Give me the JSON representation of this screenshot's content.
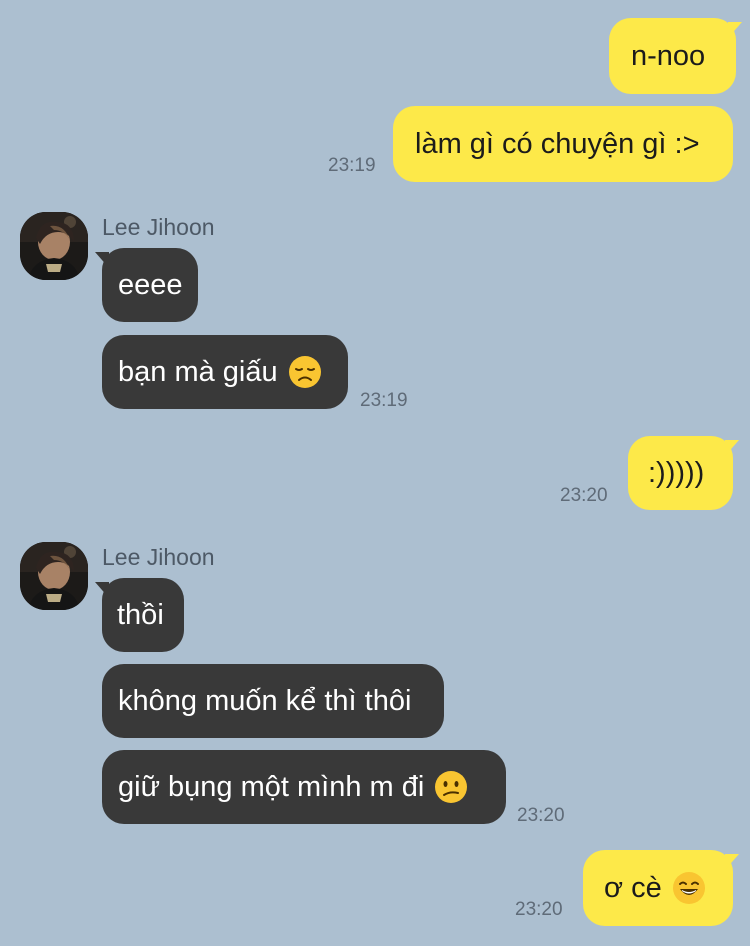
{
  "messages": [
    {
      "text": "n-noo"
    },
    {
      "text": "làm gì có chuyện gì :>",
      "time": "23:19"
    },
    {
      "sender": "Lee Jihoon",
      "text": "eeee"
    },
    {
      "text": "bạn mà giấu",
      "emoji": "disappointed-face-emoji",
      "time": "23:19"
    },
    {
      "text": ":)))))",
      "time": "23:20"
    },
    {
      "sender": "Lee Jihoon",
      "text": "thồi"
    },
    {
      "text": "không muốn kể thì thôi"
    },
    {
      "text": "giữ bụng một mình m đi",
      "emoji": "confused-face-emoji",
      "time": "23:20"
    },
    {
      "text": "ơ cè",
      "emoji": "grinning-face-emoji",
      "time": "23:20"
    }
  ],
  "colors": {
    "background": "#acbfd0",
    "my_bubble": "#fde949",
    "their_bubble": "#393939",
    "timestamp": "#5f6b78",
    "sender_name": "#4d5966"
  },
  "icons": {
    "avatar": "contact-avatar"
  }
}
